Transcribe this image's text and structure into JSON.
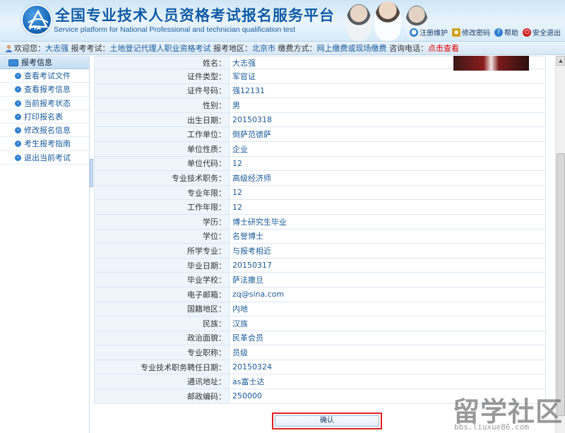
{
  "header": {
    "title_cn": "全国专业技术人员资格考试报名服务平台",
    "title_en": "Service platform for National Professional and technician qualification test",
    "logo_text": "PTA",
    "links": [
      {
        "label": "注册维护",
        "icon": "register-icon",
        "color": "#2e7fd0"
      },
      {
        "label": "修改密码",
        "icon": "lock-icon",
        "color": "#d4a020"
      },
      {
        "label": "帮助",
        "icon": "help-icon",
        "color": "#2e7fd0"
      },
      {
        "label": "安全退出",
        "icon": "power-icon",
        "color": "#d02020"
      }
    ]
  },
  "infobar": {
    "welcome_label": "欢迎您：",
    "welcome_name": "大志强",
    "exam_label": "报考考试：",
    "exam_value": "土地登记代理人职业资格考试",
    "region_label": "报考地区：",
    "region_value": "北京市",
    "pay_label": "缴费方式：",
    "pay_value": "网上缴费或现场缴费",
    "phone_label": "咨询电话：",
    "phone_value": "点击查看"
  },
  "sidebar": {
    "heading": "报考信息",
    "items": [
      {
        "label": "查看考试文件"
      },
      {
        "label": "查看报考信息"
      },
      {
        "label": "当前报考状态"
      },
      {
        "label": "打印报名表"
      },
      {
        "label": "修改报名信息"
      },
      {
        "label": "考生报考指南"
      },
      {
        "label": "退出当前考试"
      }
    ]
  },
  "form_rows": [
    {
      "label": "姓名：",
      "value": "大志强"
    },
    {
      "label": "证件类型：",
      "value": "军官证"
    },
    {
      "label": "证件号码：",
      "value": "强12131"
    },
    {
      "label": "性别：",
      "value": "男"
    },
    {
      "label": "出生日期：",
      "value": "20150318"
    },
    {
      "label": "工作单位：",
      "value": "倒萨范德萨"
    },
    {
      "label": "单位性质：",
      "value": "企业"
    },
    {
      "label": "单位代码：",
      "value": "12"
    },
    {
      "label": "专业技术职务：",
      "value": "高级经济师"
    },
    {
      "label": "专业年限：",
      "value": "12"
    },
    {
      "label": "工作年限：",
      "value": "12"
    },
    {
      "label": "学历：",
      "value": "博士研究生毕业"
    },
    {
      "label": "学位：",
      "value": "名誉博士"
    },
    {
      "label": "所学专业：",
      "value": "与报考相近"
    },
    {
      "label": "毕业日期：",
      "value": "20150317"
    },
    {
      "label": "毕业学校：",
      "value": "萨法撒旦"
    },
    {
      "label": "电子邮箱：",
      "value": "zq@sina.com"
    },
    {
      "label": "国籍地区：",
      "value": "内地"
    },
    {
      "label": "民族：",
      "value": "汉族"
    },
    {
      "label": "政治面貌：",
      "value": "民革会员"
    },
    {
      "label": "专业职称：",
      "value": "员级"
    },
    {
      "label": "专业技术职务聘任日期：",
      "value": "20150324"
    },
    {
      "label": "通讯地址：",
      "value": "as富士达"
    },
    {
      "label": "邮政编码：",
      "value": "250000"
    }
  ],
  "confirm_label": "确认",
  "watermark": {
    "big": "留学社区",
    "small": "bbs.liuxue86.com"
  }
}
